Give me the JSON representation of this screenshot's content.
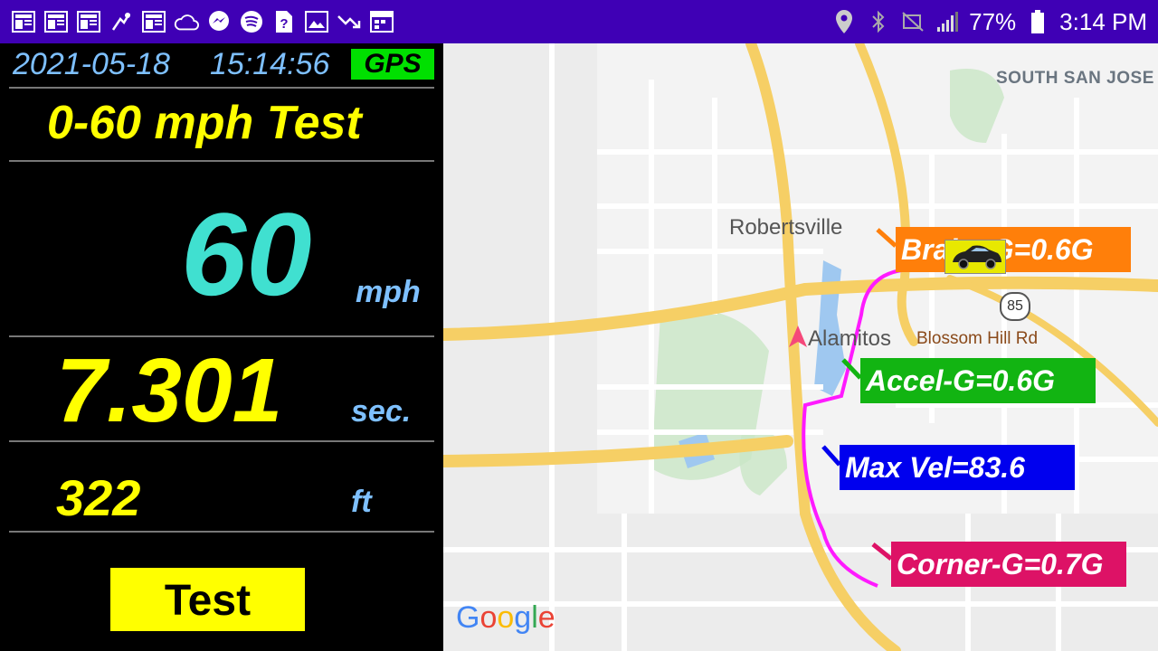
{
  "status_bar": {
    "left_icons": [
      "news-icon",
      "news-icon",
      "news-icon",
      "sync-icon",
      "news-icon",
      "cloud-icon",
      "messenger-icon",
      "spotify-icon",
      "help-icon",
      "image-icon",
      "trend-down-icon",
      "calendar-icon"
    ],
    "battery_percent": "77%",
    "time": "3:14 PM",
    "right_icons": [
      "location-icon",
      "bluetooth-icon",
      "mute-icon",
      "signal-icon",
      "battery-icon"
    ]
  },
  "header": {
    "date": "2021-05-18",
    "time": "15:14:56",
    "gps_label": "GPS"
  },
  "test": {
    "title": "0-60 mph Test",
    "speed_value": "60",
    "speed_unit": "mph",
    "time_value": "7.301",
    "time_unit": "sec.",
    "distance_value": "322",
    "distance_unit": "ft",
    "button_label": "Test"
  },
  "map": {
    "labels": {
      "south_san_jose": "SOUTH SAN JOSE",
      "robertsville": "Robertsville",
      "alamitos": "Alamitos",
      "blossom_hill": "Blossom Hill Rd",
      "highway": "85"
    },
    "google": [
      "G",
      "o",
      "o",
      "g",
      "l",
      "e"
    ],
    "tags": {
      "brake": "Brake-G=0.6G",
      "accel": "Accel-G=0.6G",
      "max_vel": "Max Vel=83.6",
      "corner": "Corner-G=0.7G"
    },
    "colors": {
      "brake": "#ff7f0a",
      "accel": "#12b412",
      "max_vel": "#0000ee",
      "corner": "#dd1266",
      "track": "#ff1aff"
    }
  }
}
